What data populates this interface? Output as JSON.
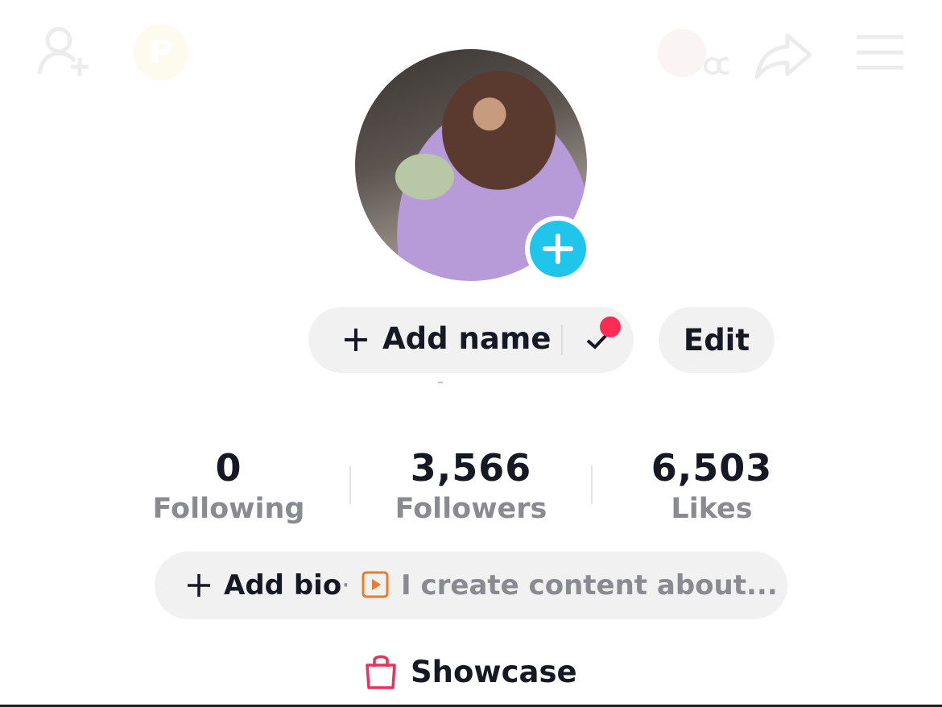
{
  "profile": {
    "add_name_label": "Add name",
    "edit_label": "Edit"
  },
  "stats": [
    {
      "value": "0",
      "label": "Following"
    },
    {
      "value": "3,566",
      "label": "Followers"
    },
    {
      "value": "6,503",
      "label": "Likes"
    }
  ],
  "bio": {
    "add_bio_label": "Add bio",
    "separator": "·",
    "placeholder": "I create content about..."
  },
  "showcase": {
    "label": "Showcase"
  },
  "colors": {
    "accent_blue": "#20c5ec",
    "notification_red": "#fe2c55",
    "showcase_pink": "#e8315d",
    "play_orange": "#f0782a",
    "pill_bg": "#f1f1f2",
    "muted_text": "#8a8b91"
  },
  "icons": {
    "top_left": [
      "add-friend-icon",
      "coin-badge-icon"
    ],
    "top_right": [
      "friends-avatar-icon",
      "share-icon",
      "menu-icon"
    ]
  }
}
